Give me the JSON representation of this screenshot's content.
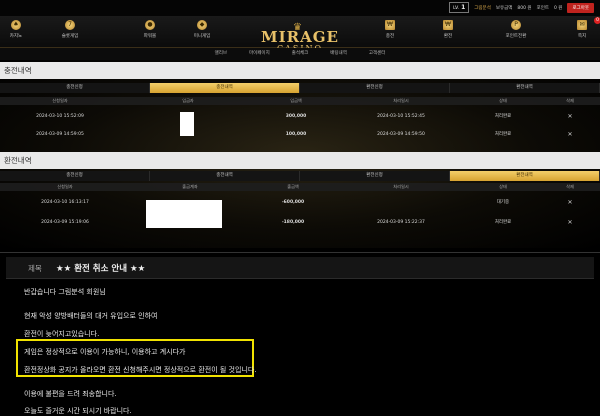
{
  "header": {
    "lv_label": "LV.",
    "lv_value": "1",
    "username": "그림분석",
    "balance_label": "보유금액",
    "balance_value": "800 원",
    "points_label": "포인트",
    "points_value": "0 원",
    "logout_label": "로그아웃"
  },
  "nav": {
    "items": [
      "카지노",
      "슬롯게임",
      "파워볼",
      "미니게임",
      "충전",
      "환전",
      "포인트전환",
      "쪽지"
    ],
    "badge": "0"
  },
  "logo": {
    "line1": "MIRAGE",
    "line2": "CASINO"
  },
  "subnav": [
    "앨리브",
    "마이페이지",
    "출석체크",
    "배팅내역",
    "고객센터"
  ],
  "charge": {
    "title": "충전내역",
    "tabs": [
      "충전신청",
      "충전내역",
      "환전신청",
      "환전내역"
    ],
    "headers": [
      "신청일자",
      "입금자",
      "입금액",
      "처리일시",
      "상태",
      "삭제"
    ],
    "rows": [
      {
        "date": "2024-03-10 15:52:09",
        "amount": "300,000",
        "done": "2024-03-10 15:52:45",
        "status": "처리완료",
        "del": "✕"
      },
      {
        "date": "2024-03-09 14:59:05",
        "amount": "100,000",
        "done": "2024-03-09 14:59:50",
        "status": "처리완료",
        "del": "✕"
      }
    ]
  },
  "withdraw": {
    "title": "환전내역",
    "tabs": [
      "충전신청",
      "충전내역",
      "환전신청",
      "환전내역"
    ],
    "headers": [
      "신청일자",
      "출금계좌",
      "출금액",
      "처리일시",
      "상태",
      "삭제"
    ],
    "rows": [
      {
        "date": "2024-03-10 16:13:17",
        "amount": "-600,000",
        "done": "",
        "status": "대기중",
        "del": "✕"
      },
      {
        "date": "2024-03-09 15:19:06",
        "amount": "-180,000",
        "done": "2024-03-09 15:22:37",
        "status": "처리완료",
        "del": "✕"
      }
    ]
  },
  "notice": {
    "label": "제목",
    "title": "★★ 환전 취소 안내 ★★",
    "lines": [
      "반갑습니다 그림분석 회원님",
      "현재 악성 양방배터들의 대거 유입으로 인하여",
      "환전이 늦어지고있습니다.",
      "게임은 정상적으로 이용이 가능하니, 이용하고 계시다가",
      "환전정상화 공지가 올라오면 환전 신청해주시면 정상적으로 환전이 될 것입니다.",
      "이용에 불편을 드려 죄송합니다.",
      "오늘도 즐거운 시간 되시기 바랍니다."
    ]
  }
}
